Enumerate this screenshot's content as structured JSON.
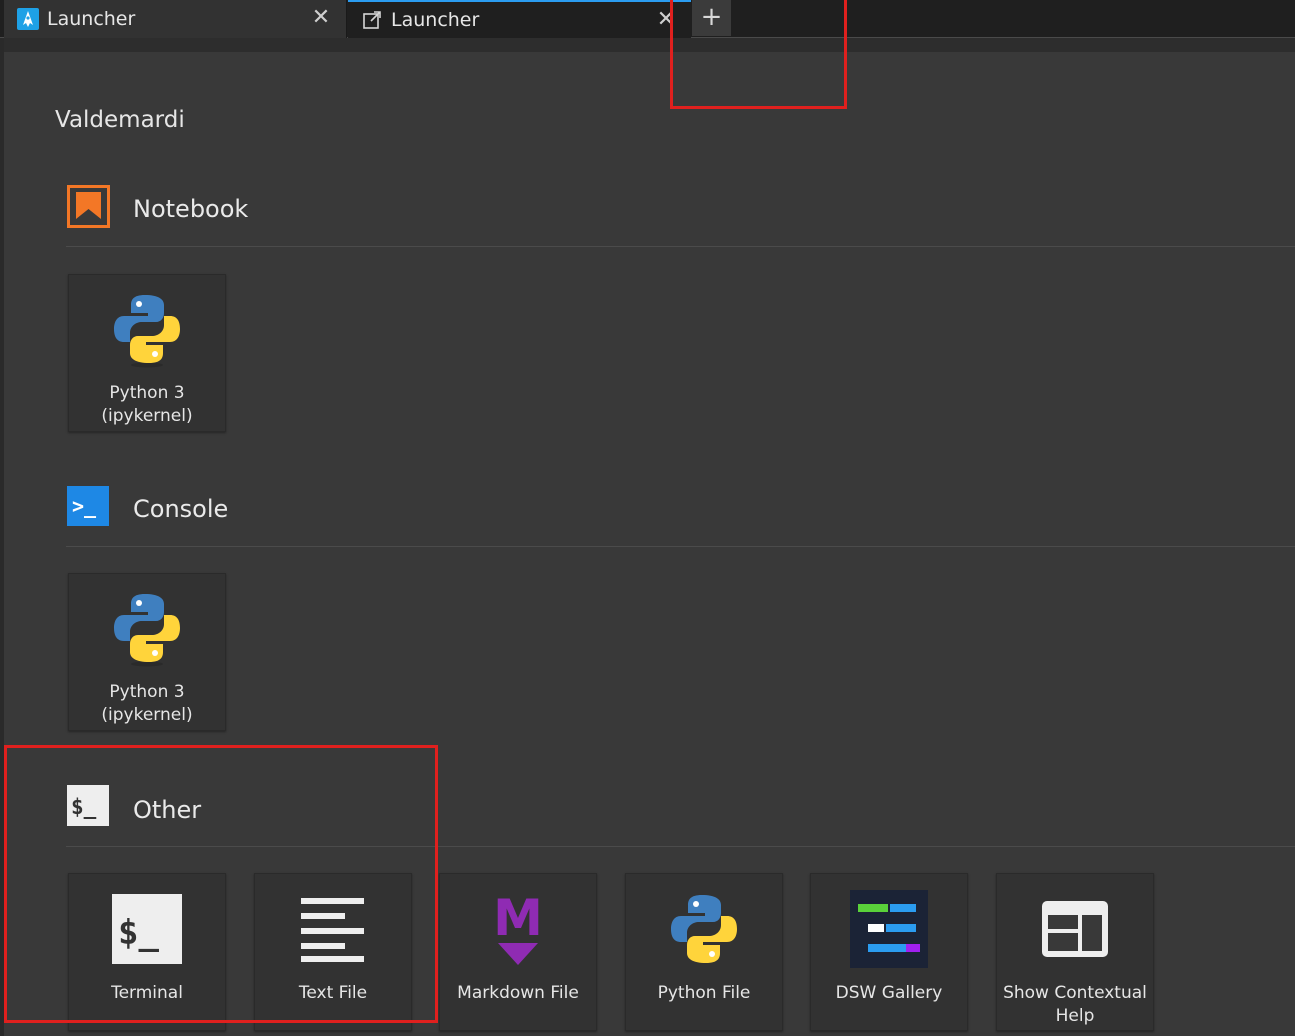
{
  "tabs": [
    {
      "label": "Launcher",
      "close": "✕"
    },
    {
      "label": "Launcher",
      "close": "✕"
    }
  ],
  "add_tab_label": "+",
  "cwd": "Valdemardi",
  "sections": {
    "notebook": {
      "title": "Notebook",
      "cards": [
        {
          "label": "Python 3 (ipykernel)"
        }
      ]
    },
    "console": {
      "title": "Console",
      "cards": [
        {
          "label": "Python 3 (ipykernel)"
        }
      ]
    },
    "other": {
      "title": "Other",
      "cards": [
        {
          "label": "Terminal"
        },
        {
          "label": "Text File"
        },
        {
          "label": "Markdown File"
        },
        {
          "label": "Python File"
        },
        {
          "label": "DSW Gallery"
        },
        {
          "label": "Show Contextual Help"
        }
      ]
    }
  },
  "icons": {
    "tab1": "launcher-rocket-icon",
    "tab2": "external-link-icon",
    "notebook": "notebook-bookmark-icon",
    "console": "console-prompt-icon",
    "other": "terminal-dollar-icon",
    "python": "python-logo-icon",
    "terminal_glyph": "$_",
    "other_glyph": "$_",
    "console_glyph": ">_",
    "markdown_glyph": "M"
  },
  "colors": {
    "accent_blue": "#2b9cf0",
    "notebook_orange": "#f37726",
    "console_blue": "#1e88e5",
    "markdown_purple": "#8f2bb3",
    "annotation_red": "#e0201e"
  }
}
